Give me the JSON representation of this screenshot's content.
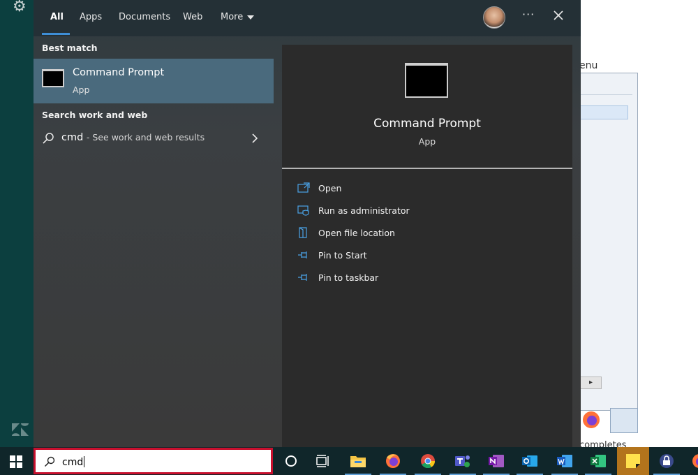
{
  "tabs": [
    {
      "label": "All",
      "active": true
    },
    {
      "label": "Apps"
    },
    {
      "label": "Documents"
    },
    {
      "label": "Web"
    },
    {
      "label": "More"
    }
  ],
  "header": {
    "more_icon": "more-dots-icon",
    "close_icon": "close-icon",
    "avatar": "user-avatar"
  },
  "left": {
    "best_match_heading": "Best match",
    "best_match": {
      "title": "Command Prompt",
      "subtitle": "App"
    },
    "search_web_heading": "Search work and web",
    "web_result": {
      "query": "cmd",
      "suffix": "- See work and web results"
    }
  },
  "right": {
    "title": "Command Prompt",
    "subtitle": "App",
    "actions": [
      {
        "label": "Open",
        "icon": "open-icon"
      },
      {
        "label": "Run as administrator",
        "icon": "shield-icon"
      },
      {
        "label": "Open file location",
        "icon": "folder-icon"
      },
      {
        "label": "Pin to Start",
        "icon": "pin-icon"
      },
      {
        "label": "Pin to taskbar",
        "icon": "pin-icon"
      }
    ]
  },
  "taskbar": {
    "search_value": "cmd",
    "apps": [
      "cortana",
      "task-view",
      "file-explorer",
      "firefox",
      "chrome",
      "teams",
      "onenote",
      "outlook",
      "word",
      "excel",
      "sticky-notes",
      "keepass",
      "firefox-alt"
    ]
  },
  "background": {
    "menu_text": "enu",
    "bottom_text": "completes"
  },
  "colors": {
    "accent": "#3e8ed6",
    "best_match_bg": "#4a6a7d",
    "search_border": "#c8102e"
  }
}
